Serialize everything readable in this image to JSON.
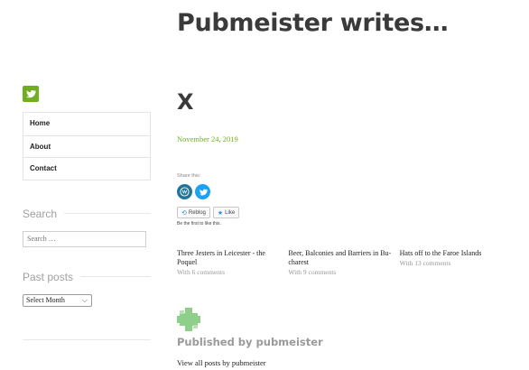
{
  "site": {
    "title": "Pubmeister writes…"
  },
  "sidebar": {
    "social_icon": "twitter-icon",
    "nav": [
      {
        "label": "Home"
      },
      {
        "label": "About"
      },
      {
        "label": "Contact"
      }
    ],
    "search": {
      "title": "Search",
      "placeholder": "Search …"
    },
    "past_posts": {
      "title": "Past posts",
      "selected": "Select Month"
    }
  },
  "post": {
    "title": "X",
    "date": "November 24, 2019",
    "share": {
      "label": "Share this:",
      "buttons": [
        "wordpress-icon",
        "twitter-icon"
      ]
    },
    "like": {
      "reblog": "Reblog",
      "like": "Like",
      "note": "Be the first to like this."
    },
    "related": [
      {
        "title_line1": "Three Jesters in Leicester - the",
        "title_line2": "Poquel",
        "meta": "With 6 comments"
      },
      {
        "title_line1": "Beer, Balconies and Barriers in Bu-",
        "title_line2": "charest",
        "meta": "With 9 comments"
      },
      {
        "title_line1": "Hats off to the Faroe Islands",
        "title_line2": "",
        "meta": "With 13 comments"
      }
    ]
  },
  "author": {
    "heading": "Published by pubmeister",
    "link": "View all posts by pubmeister"
  },
  "colors": {
    "accent": "#6fae21",
    "wordpress": "#21759b",
    "twitter": "#1da1f2"
  }
}
